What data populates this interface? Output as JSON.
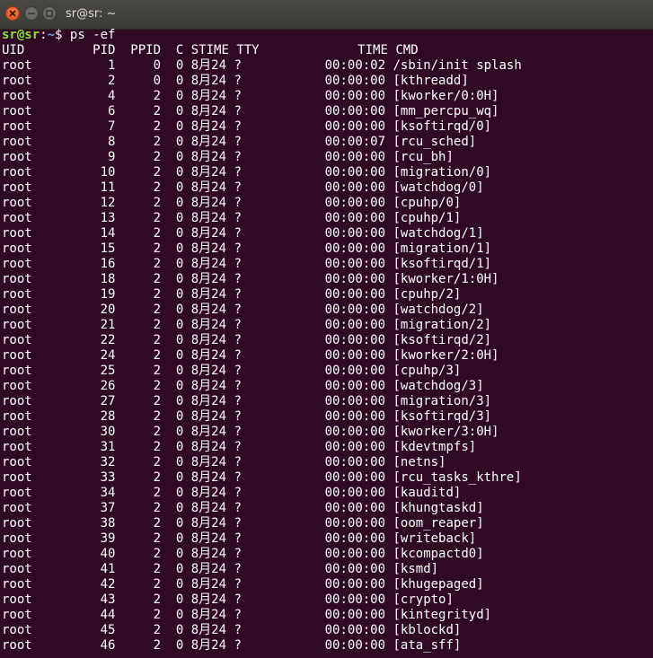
{
  "window": {
    "title": "sr@sr: ~",
    "buttons": {
      "close": "close-icon",
      "minimize": "minimize-icon",
      "maximize": "maximize-icon"
    }
  },
  "prompt": {
    "user_host": "sr@sr",
    "colon": ":",
    "path": "~",
    "symbol": "$ ",
    "command": "ps -ef"
  },
  "table": {
    "header": [
      "UID",
      "PID",
      "PPID",
      "C",
      "STIME",
      "TTY",
      "TIME",
      "CMD"
    ],
    "rows": [
      [
        "root",
        "1",
        "0",
        "0",
        "8月24",
        "?",
        "00:00:02",
        "/sbin/init splash"
      ],
      [
        "root",
        "2",
        "0",
        "0",
        "8月24",
        "?",
        "00:00:00",
        "[kthreadd]"
      ],
      [
        "root",
        "4",
        "2",
        "0",
        "8月24",
        "?",
        "00:00:00",
        "[kworker/0:0H]"
      ],
      [
        "root",
        "6",
        "2",
        "0",
        "8月24",
        "?",
        "00:00:00",
        "[mm_percpu_wq]"
      ],
      [
        "root",
        "7",
        "2",
        "0",
        "8月24",
        "?",
        "00:00:00",
        "[ksoftirqd/0]"
      ],
      [
        "root",
        "8",
        "2",
        "0",
        "8月24",
        "?",
        "00:00:07",
        "[rcu_sched]"
      ],
      [
        "root",
        "9",
        "2",
        "0",
        "8月24",
        "?",
        "00:00:00",
        "[rcu_bh]"
      ],
      [
        "root",
        "10",
        "2",
        "0",
        "8月24",
        "?",
        "00:00:00",
        "[migration/0]"
      ],
      [
        "root",
        "11",
        "2",
        "0",
        "8月24",
        "?",
        "00:00:00",
        "[watchdog/0]"
      ],
      [
        "root",
        "12",
        "2",
        "0",
        "8月24",
        "?",
        "00:00:00",
        "[cpuhp/0]"
      ],
      [
        "root",
        "13",
        "2",
        "0",
        "8月24",
        "?",
        "00:00:00",
        "[cpuhp/1]"
      ],
      [
        "root",
        "14",
        "2",
        "0",
        "8月24",
        "?",
        "00:00:00",
        "[watchdog/1]"
      ],
      [
        "root",
        "15",
        "2",
        "0",
        "8月24",
        "?",
        "00:00:00",
        "[migration/1]"
      ],
      [
        "root",
        "16",
        "2",
        "0",
        "8月24",
        "?",
        "00:00:00",
        "[ksoftirqd/1]"
      ],
      [
        "root",
        "18",
        "2",
        "0",
        "8月24",
        "?",
        "00:00:00",
        "[kworker/1:0H]"
      ],
      [
        "root",
        "19",
        "2",
        "0",
        "8月24",
        "?",
        "00:00:00",
        "[cpuhp/2]"
      ],
      [
        "root",
        "20",
        "2",
        "0",
        "8月24",
        "?",
        "00:00:00",
        "[watchdog/2]"
      ],
      [
        "root",
        "21",
        "2",
        "0",
        "8月24",
        "?",
        "00:00:00",
        "[migration/2]"
      ],
      [
        "root",
        "22",
        "2",
        "0",
        "8月24",
        "?",
        "00:00:00",
        "[ksoftirqd/2]"
      ],
      [
        "root",
        "24",
        "2",
        "0",
        "8月24",
        "?",
        "00:00:00",
        "[kworker/2:0H]"
      ],
      [
        "root",
        "25",
        "2",
        "0",
        "8月24",
        "?",
        "00:00:00",
        "[cpuhp/3]"
      ],
      [
        "root",
        "26",
        "2",
        "0",
        "8月24",
        "?",
        "00:00:00",
        "[watchdog/3]"
      ],
      [
        "root",
        "27",
        "2",
        "0",
        "8月24",
        "?",
        "00:00:00",
        "[migration/3]"
      ],
      [
        "root",
        "28",
        "2",
        "0",
        "8月24",
        "?",
        "00:00:00",
        "[ksoftirqd/3]"
      ],
      [
        "root",
        "30",
        "2",
        "0",
        "8月24",
        "?",
        "00:00:00",
        "[kworker/3:0H]"
      ],
      [
        "root",
        "31",
        "2",
        "0",
        "8月24",
        "?",
        "00:00:00",
        "[kdevtmpfs]"
      ],
      [
        "root",
        "32",
        "2",
        "0",
        "8月24",
        "?",
        "00:00:00",
        "[netns]"
      ],
      [
        "root",
        "33",
        "2",
        "0",
        "8月24",
        "?",
        "00:00:00",
        "[rcu_tasks_kthre]"
      ],
      [
        "root",
        "34",
        "2",
        "0",
        "8月24",
        "?",
        "00:00:00",
        "[kauditd]"
      ],
      [
        "root",
        "37",
        "2",
        "0",
        "8月24",
        "?",
        "00:00:00",
        "[khungtaskd]"
      ],
      [
        "root",
        "38",
        "2",
        "0",
        "8月24",
        "?",
        "00:00:00",
        "[oom_reaper]"
      ],
      [
        "root",
        "39",
        "2",
        "0",
        "8月24",
        "?",
        "00:00:00",
        "[writeback]"
      ],
      [
        "root",
        "40",
        "2",
        "0",
        "8月24",
        "?",
        "00:00:00",
        "[kcompactd0]"
      ],
      [
        "root",
        "41",
        "2",
        "0",
        "8月24",
        "?",
        "00:00:00",
        "[ksmd]"
      ],
      [
        "root",
        "42",
        "2",
        "0",
        "8月24",
        "?",
        "00:00:00",
        "[khugepaged]"
      ],
      [
        "root",
        "43",
        "2",
        "0",
        "8月24",
        "?",
        "00:00:00",
        "[crypto]"
      ],
      [
        "root",
        "44",
        "2",
        "0",
        "8月24",
        "?",
        "00:00:00",
        "[kintegrityd]"
      ],
      [
        "root",
        "45",
        "2",
        "0",
        "8月24",
        "?",
        "00:00:00",
        "[kblockd]"
      ],
      [
        "root",
        "46",
        "2",
        "0",
        "8月24",
        "?",
        "00:00:00",
        "[ata_sff]"
      ]
    ]
  },
  "colors": {
    "background": "#300a24",
    "text": "#ffffff",
    "prompt_user": "#8ae234",
    "prompt_path": "#729fcf",
    "titlebar": "#3c3b37",
    "close_button": "#df4a16"
  }
}
